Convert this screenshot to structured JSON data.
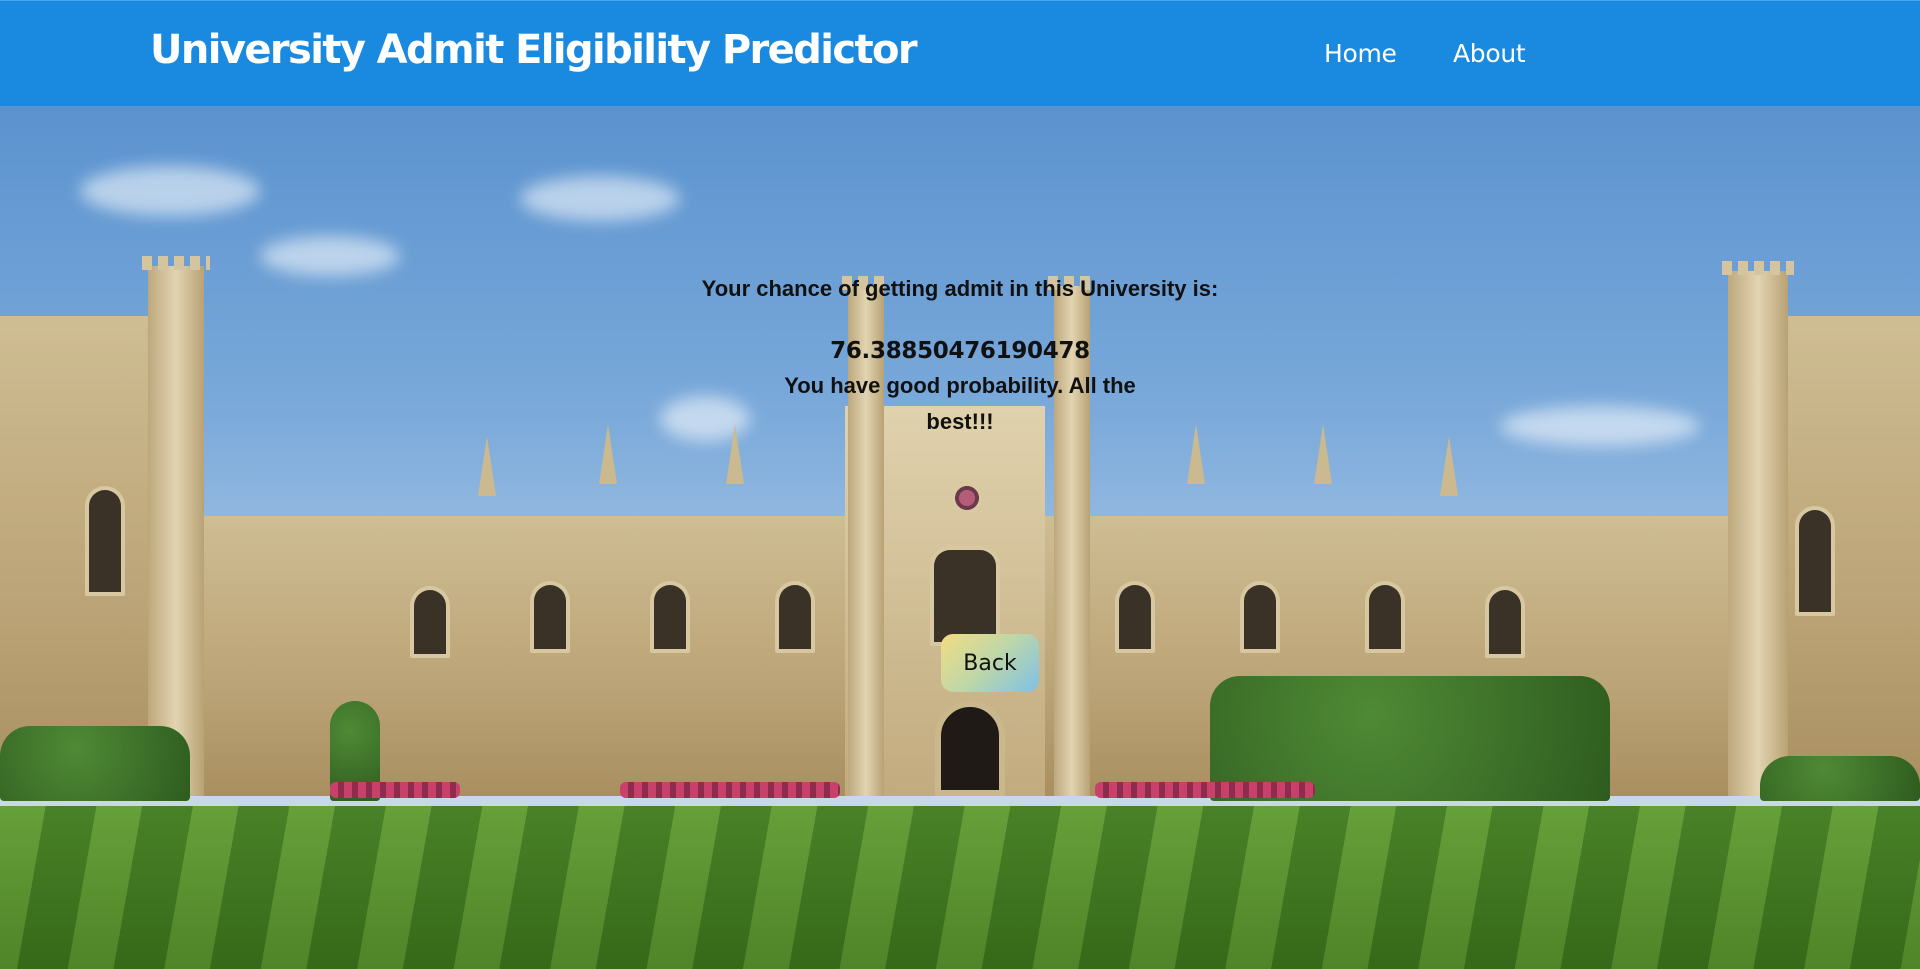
{
  "navbar": {
    "brand": "University Admit Eligibility Predictor",
    "links": [
      {
        "label": "Home"
      },
      {
        "label": "About"
      }
    ],
    "background_color": "#1a8ae0"
  },
  "result": {
    "heading": "Your chance of getting admit in this University is:",
    "value": "76.38850476190478",
    "message": "You have good probability. All the best!!!"
  },
  "actions": {
    "back_label": "Back"
  }
}
